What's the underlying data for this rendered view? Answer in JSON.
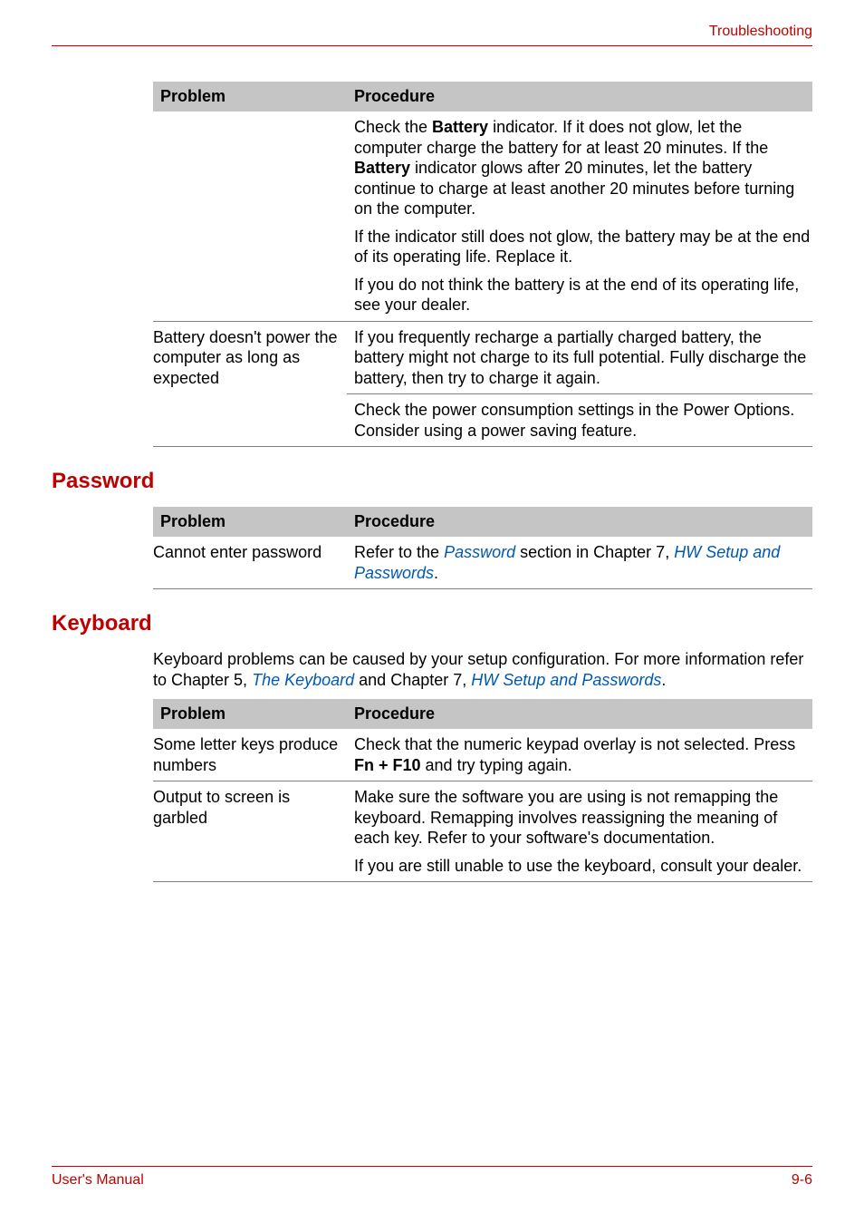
{
  "header": {
    "right": "Troubleshooting"
  },
  "table1": {
    "col1": "Problem",
    "col2": "Procedure",
    "r1p1_a": "Check the ",
    "r1p1_b": "Battery",
    "r1p1_c": " indicator. If it does not glow, let the computer charge the battery for at least 20 minutes. If the ",
    "r1p1_d": "Battery",
    "r1p1_e": " indicator glows after 20 minutes, let the battery continue to charge at least another 20 minutes before turning on the computer.",
    "r1p2": "If the indicator still does not glow, the battery may be at the end of its operating life. Replace it.",
    "r1p3": "If you do not think the battery is at the end of its operating life, see your dealer.",
    "r2left": "Battery doesn't power the computer as long as expected",
    "r2p1": "If you frequently recharge a partially charged battery, the battery might not charge to its full potential. Fully discharge the battery, then try to charge it again.",
    "r2p2": "Check the power consumption settings in the Power Options. Consider using a power saving feature."
  },
  "password": {
    "heading": "Password",
    "col1": "Problem",
    "col2": "Procedure",
    "left": "Cannot enter password",
    "right_a": "Refer to the ",
    "right_b": "Password",
    "right_c": " section in Chapter 7, ",
    "right_d": "HW Setup and Passwords",
    "right_e": "."
  },
  "keyboard": {
    "heading": "Keyboard",
    "intro_a": "Keyboard problems can be caused by your setup configuration. For more information refer to Chapter 5, ",
    "intro_b": "The Keyboard",
    "intro_c": " and Chapter 7, ",
    "intro_d": "HW Setup and Passwords",
    "intro_e": ".",
    "col1": "Problem",
    "col2": "Procedure",
    "r1left": "Some letter keys produce numbers",
    "r1p_a": "Check that the numeric keypad overlay is not selected. Press ",
    "r1p_b": "Fn + F10",
    "r1p_c": " and try typing again.",
    "r2left": "Output to screen is garbled",
    "r2p1": "Make sure the software you are using is not remapping the keyboard. Remapping involves reassigning the meaning of each key. Refer to your software's documentation.",
    "r2p2": "If you are still unable to use the keyboard, consult your dealer."
  },
  "footer": {
    "left": "User's Manual",
    "right": "9-6"
  }
}
